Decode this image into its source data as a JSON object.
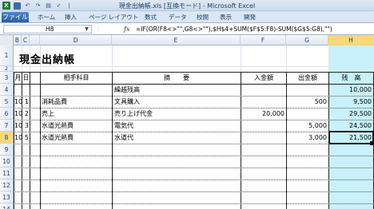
{
  "window": {
    "title": "現金出納帳.xls [互換モード] - Microsoft Excel"
  },
  "qat": {
    "app_icon": "excel-icon",
    "undo_glyph": "↶",
    "redo_glyph": "↷",
    "separator": "|"
  },
  "ribbon": {
    "file_tab": "ファイル",
    "tabs": [
      "ホーム",
      "挿入",
      "ページ レイアウト",
      "数式",
      "データ",
      "校閲",
      "表示",
      "開発"
    ]
  },
  "formula_bar": {
    "name_box": "H8",
    "fx_label": "fx",
    "formula": "=IF(OR(F8<>\"\",G8<>\"\"),$H$4+SUM($F$5:F8)-SUM($G$5:G8),\"\")"
  },
  "columns": [
    "B",
    "C",
    "D",
    "E",
    "F",
    "G",
    "H"
  ],
  "rows": [
    "1",
    "2",
    "3",
    "4",
    "5",
    "6",
    "7",
    "8",
    "9",
    "10",
    "11",
    "12",
    "13",
    "14"
  ],
  "sheet": {
    "title": "現金出納帳",
    "headers": {
      "month": "月",
      "day": "日",
      "account": "相手科目",
      "description": "摘　　要",
      "income": "入金額",
      "expense": "出金額",
      "balance": "残　高"
    },
    "carryover": {
      "description": "繰越残高",
      "balance": "10,000"
    },
    "entries": [
      {
        "month": "10",
        "day": "1",
        "account": "消耗品費",
        "description": "文具購入",
        "income": "",
        "expense": "500",
        "balance": "9,500"
      },
      {
        "month": "10",
        "day": "2",
        "account": "売上",
        "description": "売り上げ代金",
        "income": "20,000",
        "expense": "",
        "balance": "29,500"
      },
      {
        "month": "10",
        "day": "3",
        "account": "水道光熱費",
        "description": "電気代",
        "income": "",
        "expense": "5,000",
        "balance": "24,500"
      },
      {
        "month": "10",
        "day": "5",
        "account": "水道光熱費",
        "description": "水道代",
        "income": "",
        "expense": "3,000",
        "balance": "21,500"
      }
    ]
  },
  "colors": {
    "selected_header": "#f8d878",
    "balance_column": "#c8f1fb",
    "ribbon": "#dbe6f4",
    "file_tab": "#2a5d9f"
  }
}
